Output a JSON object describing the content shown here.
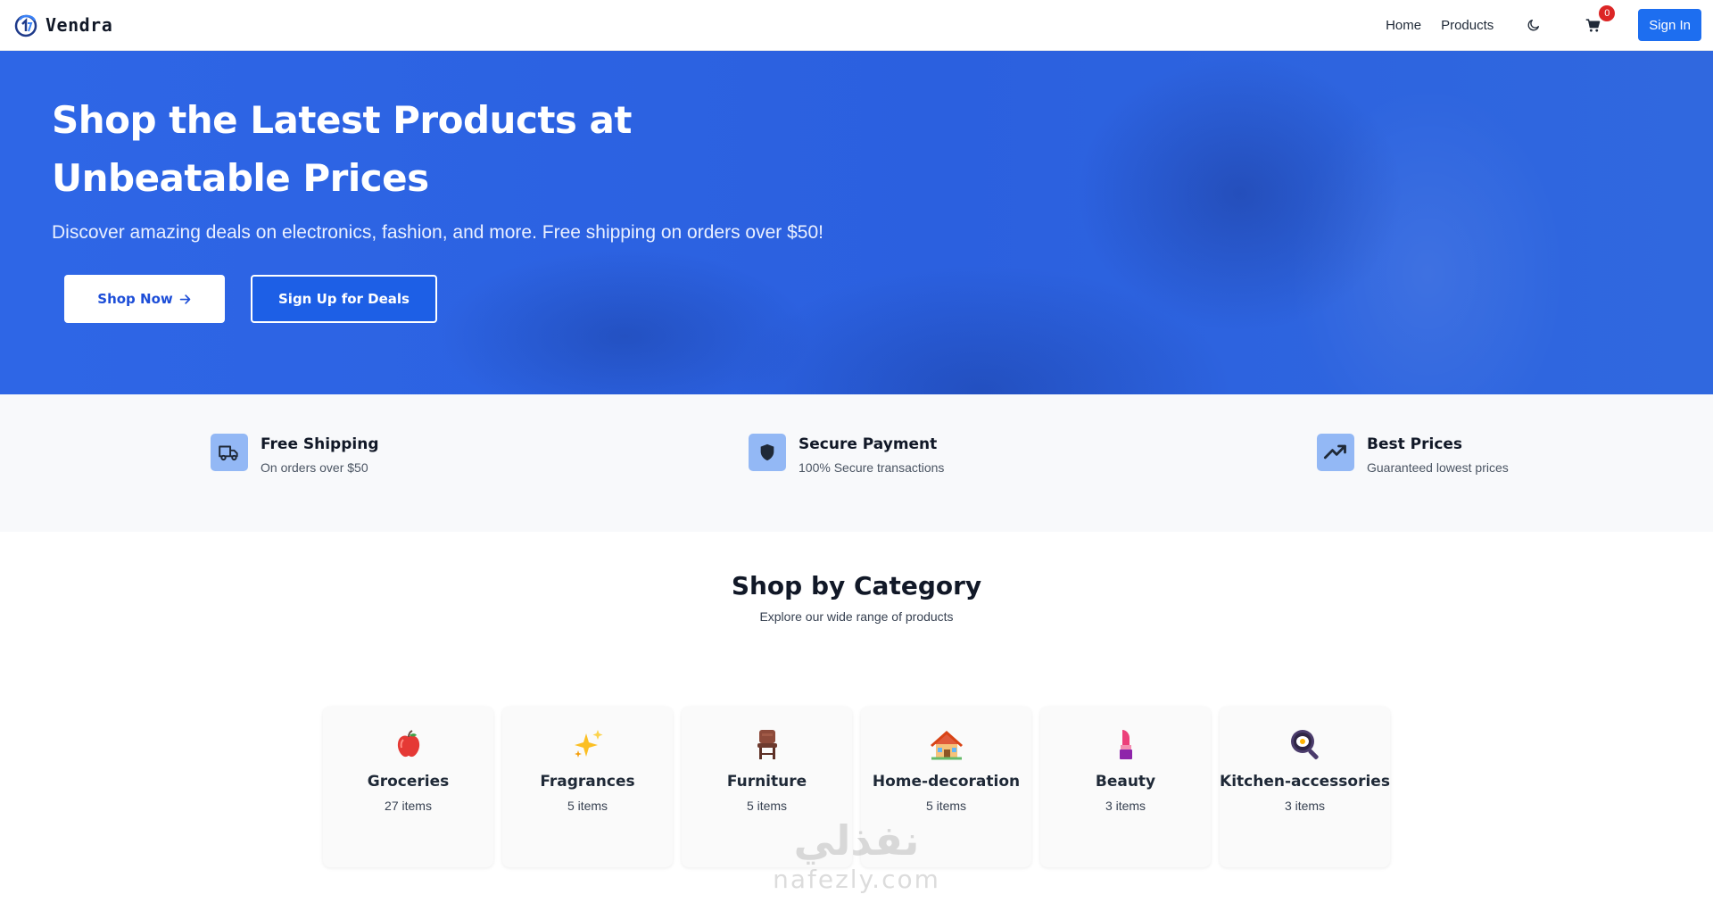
{
  "navbar": {
    "brand": "Vendra",
    "links": [
      "Home",
      "Products"
    ],
    "cart_count": "0",
    "signin_label": "Sign In",
    "theme_icon": "moon-icon",
    "cart_icon": "cart-icon"
  },
  "hero": {
    "title": "Shop the Latest Products at Unbeatable Prices",
    "subtitle": "Discover amazing deals on electronics, fashion, and more. Free shipping on orders over $50!",
    "shop_button": "Shop Now",
    "deals_button": "Sign Up for Deals"
  },
  "features": [
    {
      "icon": "truck-icon",
      "title": "Free Shipping",
      "subtitle": "On orders over $50"
    },
    {
      "icon": "shield-icon",
      "title": "Secure Payment",
      "subtitle": "100% Secure transactions"
    },
    {
      "icon": "trending-up-icon",
      "title": "Best Prices",
      "subtitle": "Guaranteed lowest prices"
    }
  ],
  "categories_section": {
    "title": "Shop by Category",
    "subtitle": "Explore our wide range of products",
    "items": [
      {
        "name": "Groceries",
        "count": "27 items",
        "icon": "apple-icon"
      },
      {
        "name": "Fragrances",
        "count": "5 items",
        "icon": "sparkles-icon"
      },
      {
        "name": "Furniture",
        "count": "5 items",
        "icon": "chair-icon"
      },
      {
        "name": "Home-decoration",
        "count": "5 items",
        "icon": "house-icon"
      },
      {
        "name": "Beauty",
        "count": "3 items",
        "icon": "lipstick-icon"
      },
      {
        "name": "Kitchen-accessories",
        "count": "3 items",
        "icon": "frying-pan-icon"
      }
    ]
  },
  "watermark": {
    "arabic": "نفذلي",
    "latin": "nafezly.com"
  },
  "colors": {
    "primary": "#1d6ef0",
    "hero": "#2f67e0",
    "feature_icon_bg": "#93b8f5",
    "badge": "#dc2626"
  }
}
